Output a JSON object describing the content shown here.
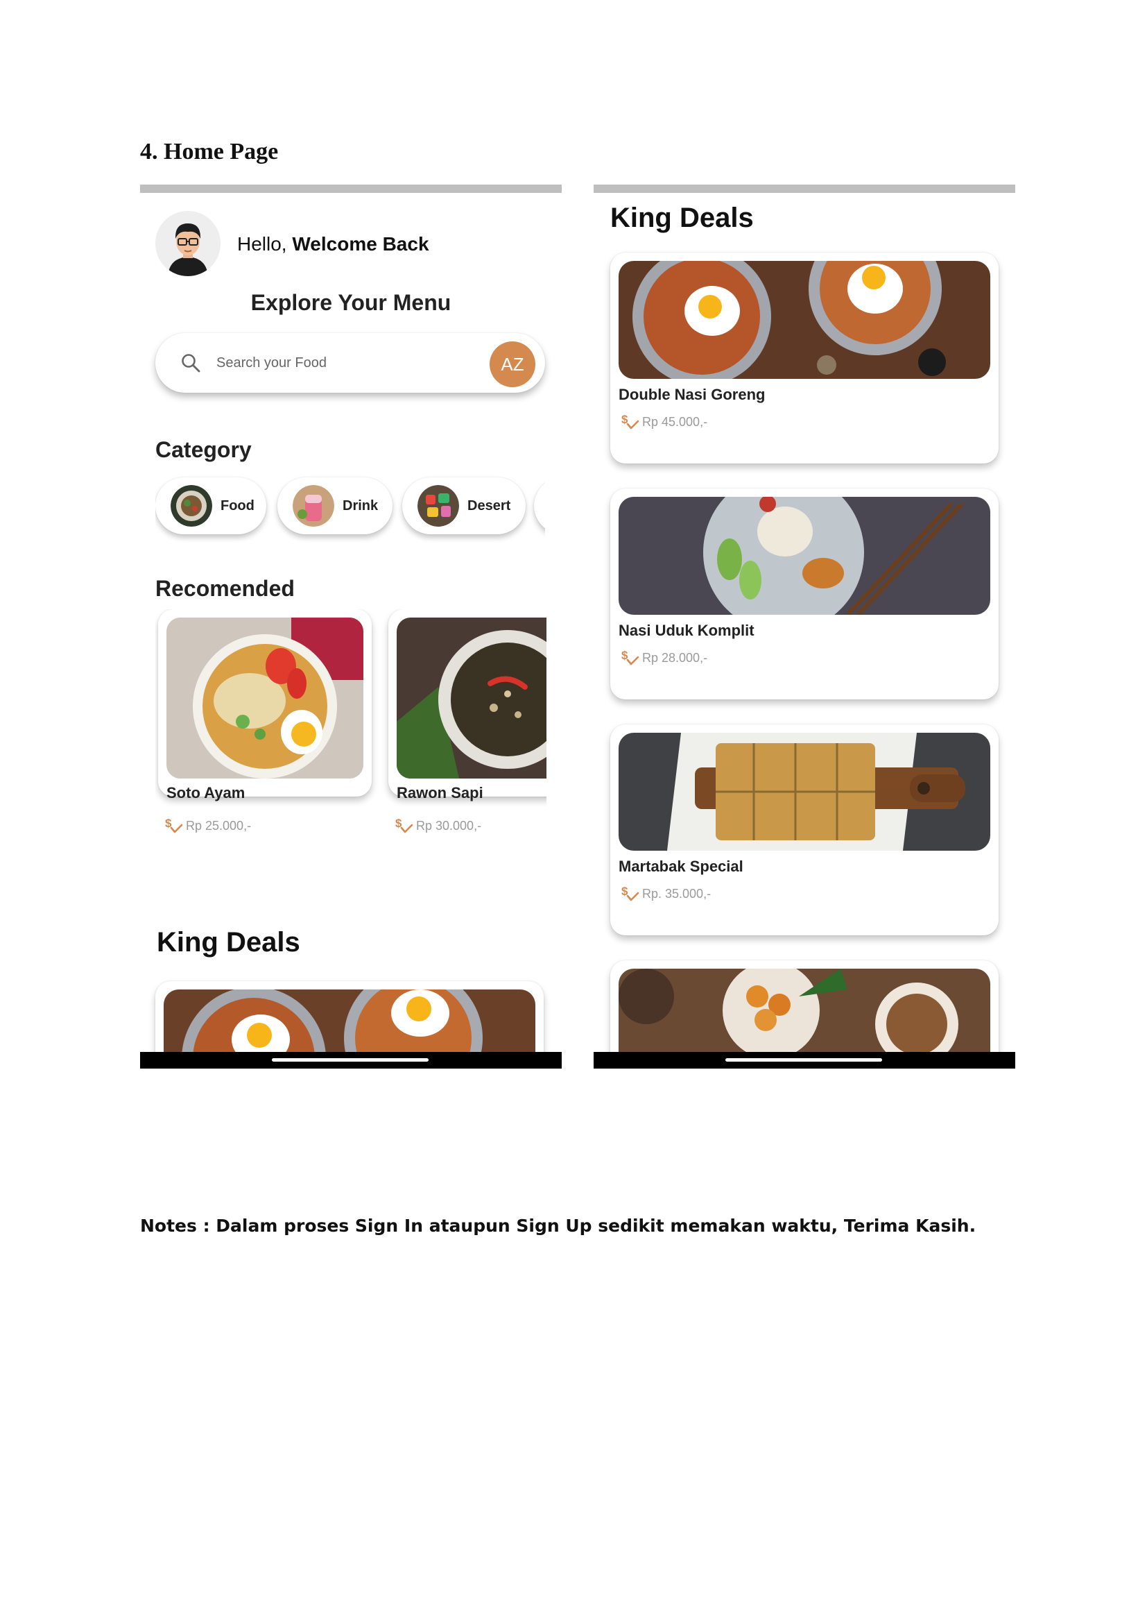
{
  "document": {
    "section_heading": "4. Home Page",
    "notes": "Notes : Dalam proses Sign In ataupun Sign Up sedikit memakan waktu, Terima Kasih."
  },
  "home": {
    "greeting_prefix": "Hello,",
    "greeting_name": "Welcome Back",
    "explore_title": "Explore Your Menu",
    "search": {
      "placeholder": "Search your Food",
      "sort_label": "AZ"
    },
    "category_title": "Category",
    "categories": [
      {
        "label": "Food"
      },
      {
        "label": "Drink"
      },
      {
        "label": "Desert"
      }
    ],
    "recommended_title": "Recomended",
    "recommended": [
      {
        "name": "Soto Ayam",
        "price": "Rp 25.000,-"
      },
      {
        "name": "Rawon Sapi",
        "price": "Rp 30.000,-"
      }
    ],
    "king_deals_title": "King Deals"
  },
  "king_deals_page": {
    "title": "King Deals",
    "deals": [
      {
        "name": "Double Nasi Goreng",
        "price": "Rp 45.000,-"
      },
      {
        "name": "Nasi Uduk Komplit",
        "price": "Rp 28.000,-"
      },
      {
        "name": "Martabak Special",
        "price": "Rp. 35.000,-"
      }
    ]
  },
  "colors": {
    "accent": "#d4894e",
    "status_bar": "#bfbfbf",
    "nav_bar": "#000000"
  },
  "icons": {
    "search": "search-icon",
    "sort": "sort-az-icon",
    "price": "dollar-check-icon"
  }
}
